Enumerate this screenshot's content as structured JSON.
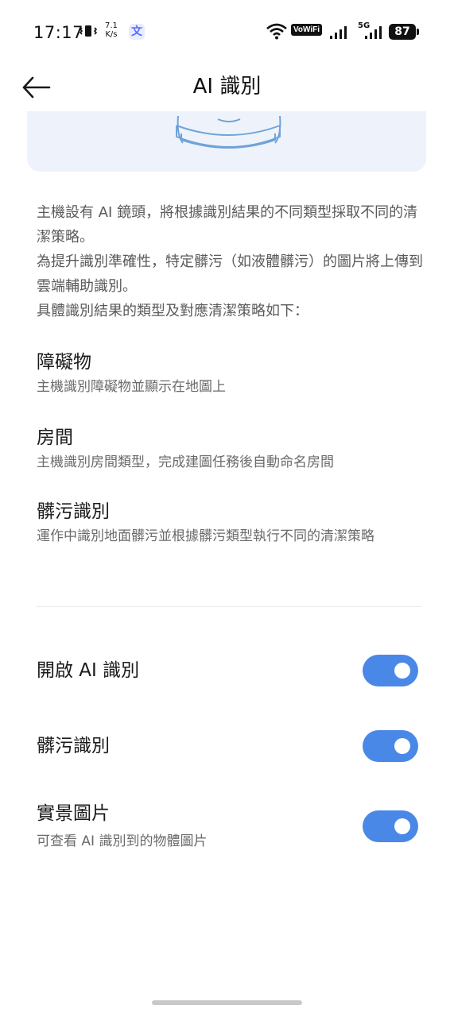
{
  "status_bar": {
    "time": "17:17",
    "net_speed_value": "7.1",
    "net_speed_unit": "K/s",
    "vowifi": "VoWiFi",
    "network": "5G",
    "battery": "87"
  },
  "header": {
    "title": "AI 識別"
  },
  "description": [
    "主機設有 AI 鏡頭，將根據識別結果的不同類型採取不同的清潔策略。",
    "為提升識別準確性，特定髒污（如液體髒污）的圖片將上傳到雲端輔助識別。",
    "具體識別結果的類型及對應清潔策略如下："
  ],
  "types": [
    {
      "title": "障礙物",
      "desc": "主機識別障礙物並顯示在地圖上"
    },
    {
      "title": "房間",
      "desc": "主機識別房間類型，完成建圖任務後自動命名房間"
    },
    {
      "title": "髒污識別",
      "desc": "運作中識別地面髒污並根據髒污類型執行不同的清潔策略"
    }
  ],
  "settings": [
    {
      "label": "開啟 AI 識別",
      "enabled": true
    },
    {
      "label": "髒污識別",
      "enabled": true
    },
    {
      "label": "實景圖片",
      "sub": "可查看 AI 識別到的物體圖片",
      "enabled": true
    }
  ],
  "colors": {
    "toggle_on": "#4a88e8",
    "hero_bg": "#eef3fb",
    "robot_stroke": "#6fa3d8"
  }
}
